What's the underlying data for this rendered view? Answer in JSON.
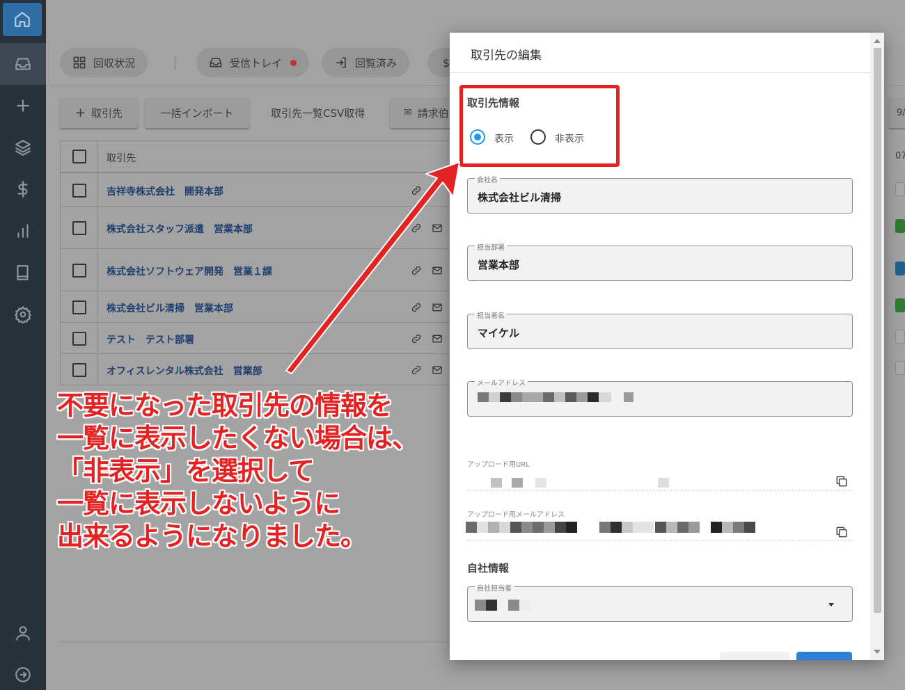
{
  "sidebar": {
    "icons": [
      "home-icon",
      "inbox-icon",
      "plus-icon",
      "layers-icon",
      "dollar-icon",
      "bar-chart-icon",
      "book-icon",
      "gear-icon",
      "user-icon",
      "logout-icon"
    ]
  },
  "tabs": {
    "collection": "回収状況",
    "inbox": "受信トレイ",
    "viewed": "回覧済み"
  },
  "actions": {
    "add_partner": "取引先",
    "bulk_import": "一括インポート",
    "csv_export": "取引先一覧CSV取得",
    "invoice": "請求伯"
  },
  "table": {
    "header": "取引先",
    "rows": [
      {
        "label": "吉祥寺株式会社　開発本部",
        "mail": false
      },
      {
        "label": "株式会社スタッフ派遣　営業本部",
        "mail": true
      },
      {
        "label": "株式会社ソフトウェア開発　営業１課",
        "mail": true
      },
      {
        "label": "株式会社ビル清掃　営業本部",
        "mail": true
      },
      {
        "label": "テスト　テスト部署",
        "mail": true
      },
      {
        "label": "オフィスレンタル株式会社　営業部",
        "mail": true
      }
    ]
  },
  "right_column": {
    "header_top": "9/",
    "header_second": "07"
  },
  "modal": {
    "title": "取引先の編集",
    "partner_section": "取引先情報",
    "radio_show": "表示",
    "radio_hide": "非表示",
    "selected": "表示",
    "fields": {
      "company_label": "会社名",
      "company_value": "株式会社ビル清掃",
      "dept_label": "担当部署",
      "dept_value": "営業本部",
      "person_label": "担当者名",
      "person_value": "マイケル",
      "email_label": "メールアドレス"
    },
    "upload_url_label": "アップロード用URL",
    "upload_mail_label": "アップロード用メールアドレス",
    "own_section": "自社情報",
    "own_person_label": "自社担当者"
  },
  "annotation": {
    "line1": "不要になった取引先の情報を",
    "line2": "一覧に表示したくない場合は、",
    "line3": "「非表示」を選択して",
    "line4": "一覧に表示しないように",
    "line5": "出来るようになりました。",
    "color": "#e32222"
  }
}
